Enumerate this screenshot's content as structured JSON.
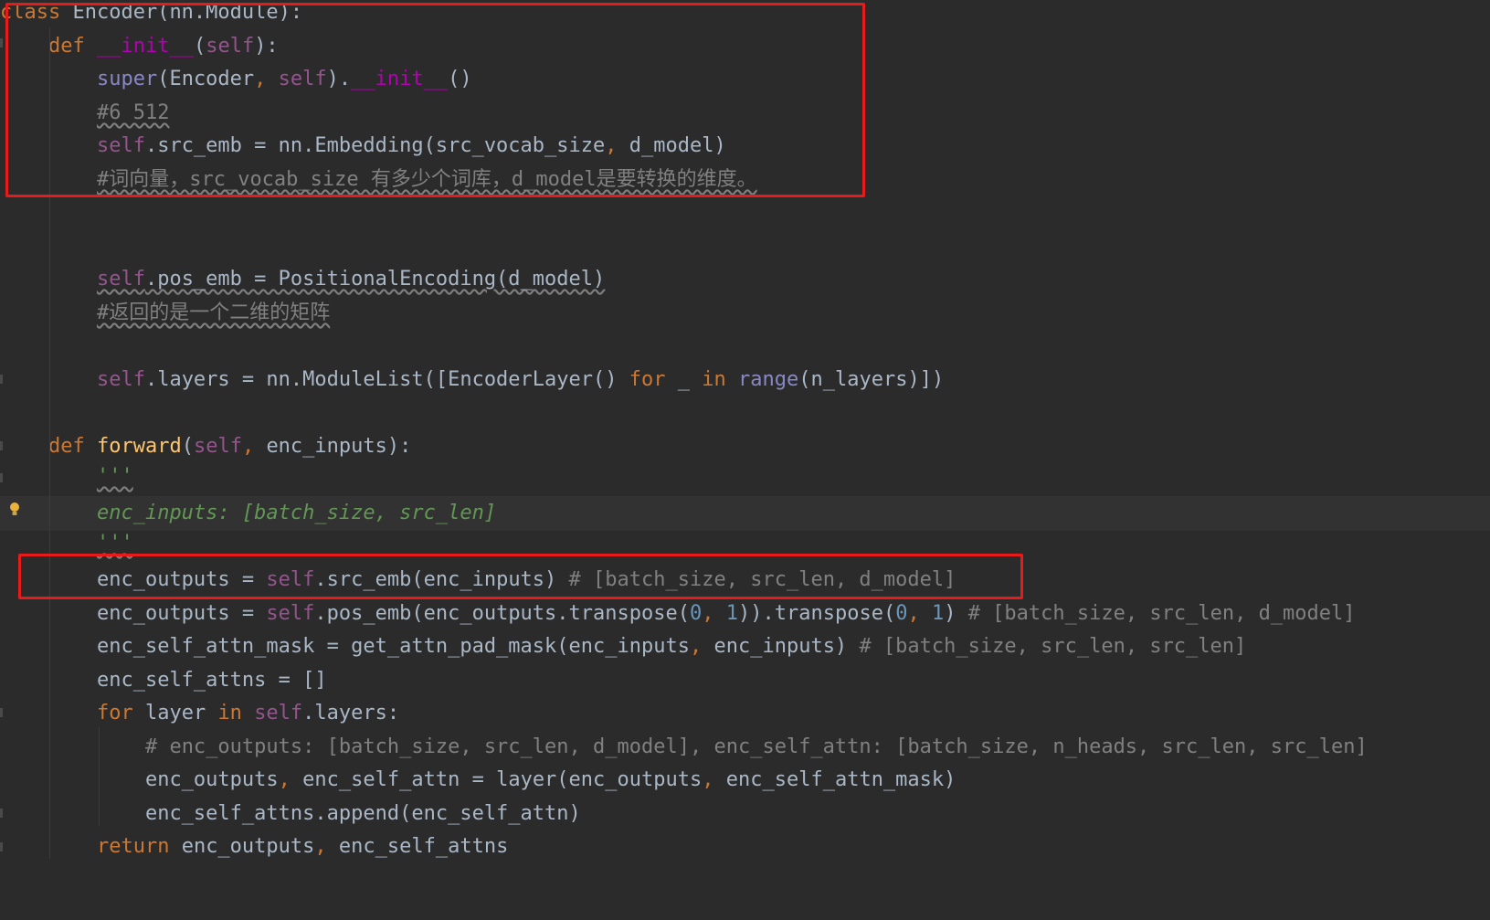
{
  "editor": {
    "colors": {
      "background": "#2b2b2b",
      "active_line": "#323232",
      "keyword": "#cc7832",
      "self": "#94558d",
      "magic": "#b200b2",
      "builtin": "#8888c6",
      "number": "#6897bb",
      "comment": "#808080",
      "docstring": "#629755",
      "function": "#ffc66d",
      "text": "#a9b7c6",
      "highlight": "#e81b1b"
    },
    "lines": [
      {
        "tokens": [
          {
            "t": "class",
            "c": "keyword"
          },
          {
            "t": " Encoder(nn.Module):",
            "c": "text"
          }
        ]
      },
      {
        "tokens": [
          {
            "t": "    ",
            "c": "text"
          },
          {
            "t": "def",
            "c": "keyword"
          },
          {
            "t": " ",
            "c": "text"
          },
          {
            "t": "__init__",
            "c": "magic"
          },
          {
            "t": "(",
            "c": "text"
          },
          {
            "t": "self",
            "c": "self"
          },
          {
            "t": "):",
            "c": "text"
          }
        ]
      },
      {
        "tokens": [
          {
            "t": "        ",
            "c": "text"
          },
          {
            "t": "super",
            "c": "builtin"
          },
          {
            "t": "(Encoder",
            "c": "text"
          },
          {
            "t": ", ",
            "c": "keyword"
          },
          {
            "t": "self",
            "c": "self"
          },
          {
            "t": ").",
            "c": "text"
          },
          {
            "t": "__init__",
            "c": "magic"
          },
          {
            "t": "()",
            "c": "text"
          }
        ]
      },
      {
        "tokens": [
          {
            "t": "        ",
            "c": "text"
          },
          {
            "t": "#6 512",
            "c": "comment"
          }
        ]
      },
      {
        "tokens": [
          {
            "t": "        ",
            "c": "text"
          },
          {
            "t": "self",
            "c": "self"
          },
          {
            "t": ".src_emb = nn.Embedding(src_vocab_size",
            "c": "text"
          },
          {
            "t": ", ",
            "c": "keyword"
          },
          {
            "t": "d_model)",
            "c": "text"
          }
        ]
      },
      {
        "tokens": [
          {
            "t": "        ",
            "c": "text"
          },
          {
            "t": "#词向量，src_vocab_size 有多少个词库，d_model是要转换的维度。",
            "c": "comment"
          }
        ]
      },
      {
        "tokens": []
      },
      {
        "tokens": []
      },
      {
        "tokens": [
          {
            "t": "        ",
            "c": "text"
          },
          {
            "t": "self",
            "c": "self"
          },
          {
            "t": ".pos_emb = PositionalEncoding(d_model)",
            "c": "text"
          }
        ]
      },
      {
        "tokens": [
          {
            "t": "        ",
            "c": "text"
          },
          {
            "t": "#返回的是一个二维的矩阵",
            "c": "comment"
          }
        ]
      },
      {
        "tokens": []
      },
      {
        "tokens": [
          {
            "t": "        ",
            "c": "text"
          },
          {
            "t": "self",
            "c": "self"
          },
          {
            "t": ".layers = nn.ModuleList([EncoderLayer() ",
            "c": "text"
          },
          {
            "t": "for",
            "c": "keyword"
          },
          {
            "t": " _ ",
            "c": "text"
          },
          {
            "t": "in",
            "c": "keyword"
          },
          {
            "t": " ",
            "c": "text"
          },
          {
            "t": "range",
            "c": "builtin"
          },
          {
            "t": "(n_layers)])",
            "c": "text"
          }
        ]
      },
      {
        "tokens": []
      },
      {
        "tokens": [
          {
            "t": "    ",
            "c": "text"
          },
          {
            "t": "def",
            "c": "keyword"
          },
          {
            "t": " ",
            "c": "text"
          },
          {
            "t": "forward",
            "c": "function"
          },
          {
            "t": "(",
            "c": "text"
          },
          {
            "t": "self",
            "c": "self"
          },
          {
            "t": ", ",
            "c": "keyword"
          },
          {
            "t": "enc_inputs):",
            "c": "text"
          }
        ]
      },
      {
        "tokens": [
          {
            "t": "        ",
            "c": "text"
          },
          {
            "t": "'''",
            "c": "docstring"
          }
        ]
      },
      {
        "tokens": [
          {
            "t": "        ",
            "c": "text"
          },
          {
            "t": "enc_inputs: [batch_size, src_len]",
            "c": "docstring"
          }
        ]
      },
      {
        "tokens": [
          {
            "t": "        ",
            "c": "text"
          },
          {
            "t": "'''",
            "c": "docstring"
          }
        ]
      },
      {
        "tokens": [
          {
            "t": "        ",
            "c": "text"
          },
          {
            "t": "enc_outputs = ",
            "c": "text"
          },
          {
            "t": "self",
            "c": "self"
          },
          {
            "t": ".src_emb(enc_inputs) ",
            "c": "text"
          },
          {
            "t": "# [batch_size, src_len, d_model]",
            "c": "comment"
          }
        ]
      },
      {
        "tokens": [
          {
            "t": "        ",
            "c": "text"
          },
          {
            "t": "enc_outputs = ",
            "c": "text"
          },
          {
            "t": "self",
            "c": "self"
          },
          {
            "t": ".pos_emb(enc_outputs.transpose(",
            "c": "text"
          },
          {
            "t": "0",
            "c": "number"
          },
          {
            "t": ", ",
            "c": "keyword"
          },
          {
            "t": "1",
            "c": "number"
          },
          {
            "t": ")).transpose(",
            "c": "text"
          },
          {
            "t": "0",
            "c": "number"
          },
          {
            "t": ", ",
            "c": "keyword"
          },
          {
            "t": "1",
            "c": "number"
          },
          {
            "t": ") ",
            "c": "text"
          },
          {
            "t": "# [batch_size, src_len, d_model]",
            "c": "comment"
          }
        ]
      },
      {
        "tokens": [
          {
            "t": "        ",
            "c": "text"
          },
          {
            "t": "enc_self_attn_mask = get_attn_pad_mask(enc_inputs",
            "c": "text"
          },
          {
            "t": ", ",
            "c": "keyword"
          },
          {
            "t": "enc_inputs) ",
            "c": "text"
          },
          {
            "t": "# [batch_size, src_len, src_len]",
            "c": "comment"
          }
        ]
      },
      {
        "tokens": [
          {
            "t": "        ",
            "c": "text"
          },
          {
            "t": "enc_self_attns = []",
            "c": "text"
          }
        ]
      },
      {
        "tokens": [
          {
            "t": "        ",
            "c": "text"
          },
          {
            "t": "for",
            "c": "keyword"
          },
          {
            "t": " layer ",
            "c": "text"
          },
          {
            "t": "in",
            "c": "keyword"
          },
          {
            "t": " ",
            "c": "text"
          },
          {
            "t": "self",
            "c": "self"
          },
          {
            "t": ".layers:",
            "c": "text"
          }
        ]
      },
      {
        "tokens": [
          {
            "t": "            ",
            "c": "text"
          },
          {
            "t": "# enc_outputs: [batch_size, src_len, d_model], enc_self_attn: [batch_size, n_heads, src_len, src_len]",
            "c": "comment"
          }
        ]
      },
      {
        "tokens": [
          {
            "t": "            ",
            "c": "text"
          },
          {
            "t": "enc_outputs",
            "c": "text"
          },
          {
            "t": ", ",
            "c": "keyword"
          },
          {
            "t": "enc_self_attn = layer(enc_outputs",
            "c": "text"
          },
          {
            "t": ", ",
            "c": "keyword"
          },
          {
            "t": "enc_self_attn_mask)",
            "c": "text"
          }
        ]
      },
      {
        "tokens": [
          {
            "t": "            ",
            "c": "text"
          },
          {
            "t": "enc_self_attns.append(enc_self_attn)",
            "c": "text"
          }
        ]
      },
      {
        "tokens": [
          {
            "t": "        ",
            "c": "text"
          },
          {
            "t": "return",
            "c": "keyword"
          },
          {
            "t": " enc_outputs",
            "c": "text"
          },
          {
            "t": ", ",
            "c": "keyword"
          },
          {
            "t": "enc_self_attns",
            "c": "text"
          }
        ]
      }
    ]
  }
}
